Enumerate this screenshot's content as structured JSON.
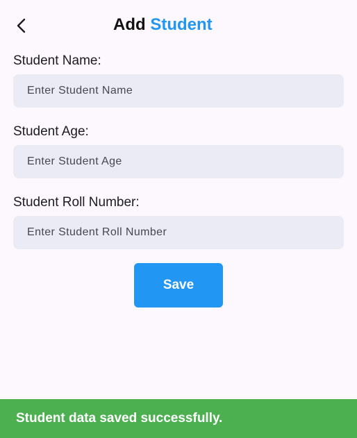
{
  "header": {
    "back_icon": "chevron-left-icon",
    "title_part1": "Add",
    "title_part2": "Student",
    "title_accent_color": "#2196f3"
  },
  "form": {
    "name_label": "Student Name:",
    "name_placeholder": "Enter Student Name",
    "name_value": "",
    "age_label": "Student Age:",
    "age_placeholder": "Enter Student Age",
    "age_value": "",
    "roll_label": "Student Roll Number:",
    "roll_placeholder": "Enter Student Roll Number",
    "roll_value": "",
    "save_label": "Save",
    "save_color": "#2196f3"
  },
  "snackbar": {
    "message": "Student data saved successfully.",
    "color": "#4caf50"
  }
}
